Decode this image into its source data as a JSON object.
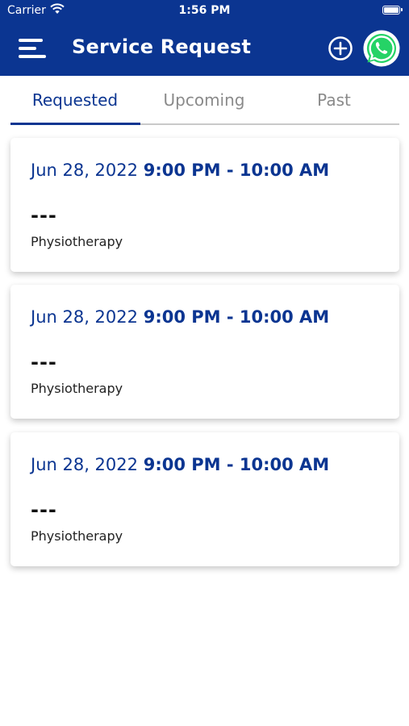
{
  "status_bar": {
    "carrier": "Carrier",
    "time": "1:56 PM"
  },
  "header": {
    "title": "Service Request",
    "menu_icon": "hamburger-icon",
    "add_icon": "plus-circle-icon",
    "whatsapp_icon": "whatsapp-icon",
    "background": "#0b3591"
  },
  "tabs": [
    {
      "label": "Requested",
      "active": true
    },
    {
      "label": "Upcoming",
      "active": false
    },
    {
      "label": "Past",
      "active": false
    }
  ],
  "requests": [
    {
      "date": "Jun 28, 2022",
      "time_range": "9:00 PM -  10:00 AM",
      "name": "---",
      "service": "Physiotherapy"
    },
    {
      "date": "Jun 28, 2022",
      "time_range": "9:00 PM -  10:00 AM",
      "name": "---",
      "service": "Physiotherapy"
    },
    {
      "date": "Jun 28, 2022",
      "time_range": "9:00 PM -  10:00 AM",
      "name": "---",
      "service": "Physiotherapy"
    }
  ],
  "colors": {
    "primary": "#0b3591",
    "inactive_tab": "#8a8a8a",
    "whatsapp": "#25d366"
  }
}
